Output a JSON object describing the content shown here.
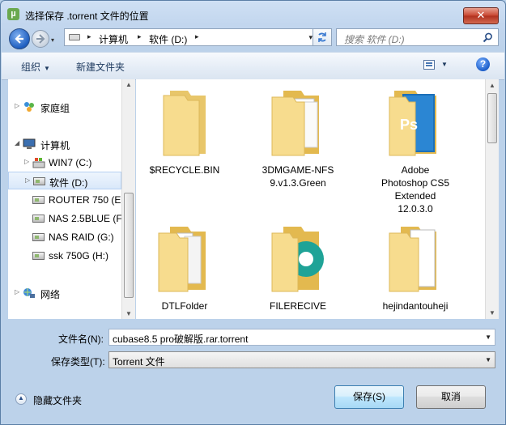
{
  "window": {
    "title": "选择保存 .torrent 文件的位置",
    "close_glyph": "✕",
    "app_icon_glyph": "µ"
  },
  "address": {
    "crumbs": [
      "计算机",
      "软件 (D:)"
    ],
    "separator": "▸",
    "dropdown_glyph": "▾"
  },
  "search": {
    "placeholder": "搜索 软件 (D:)"
  },
  "toolbar": {
    "organize_label": "组织",
    "new_folder_label": "新建文件夹",
    "caret": "▼",
    "help_glyph": "?"
  },
  "nav": {
    "items": [
      {
        "label": "家庭组",
        "arrow": "▷"
      },
      {
        "label": "计算机",
        "arrow": "◢"
      },
      {
        "label": "WIN7 (C:)",
        "arrow": "▷"
      },
      {
        "label": "软件 (D:)",
        "arrow": "▷"
      },
      {
        "label": "ROUTER 750 (E",
        "arrow": ""
      },
      {
        "label": "NAS 2.5BLUE (F",
        "arrow": ""
      },
      {
        "label": "NAS RAID (G:)",
        "arrow": ""
      },
      {
        "label": "ssk 750G (H:)",
        "arrow": ""
      },
      {
        "label": "网络",
        "arrow": "▷"
      }
    ]
  },
  "scroll": {
    "up": "▲",
    "down": "▼"
  },
  "files": {
    "items": [
      {
        "label": "$RECYCLE.BIN"
      },
      {
        "label": "3DMGAME-NFS\n9.v1.3.Green"
      },
      {
        "label": "Adobe\nPhotoshop CS5\nExtended\n12.0.3.0"
      },
      {
        "label": "DTLFolder"
      },
      {
        "label": "FILERECIVE"
      },
      {
        "label": "hejindantouheji"
      }
    ],
    "ps_badge": "Ps",
    "colors": {
      "folder": "#f5d77e",
      "folder_dark": "#e3b94f",
      "ps_blue": "#1c6fb8",
      "android_teal": "#1fa397"
    }
  },
  "form": {
    "filename_label": "文件名(N):",
    "filename_value": "cubase8.5 pro破解版.rar.torrent",
    "filetype_label": "保存类型(T):",
    "filetype_value": "Torrent 文件",
    "arrow": "▼"
  },
  "footer": {
    "hide_folders_label": "隐藏文件夹",
    "hide_glyph": "▲",
    "save_label": "保存(S)",
    "cancel_label": "取消"
  }
}
